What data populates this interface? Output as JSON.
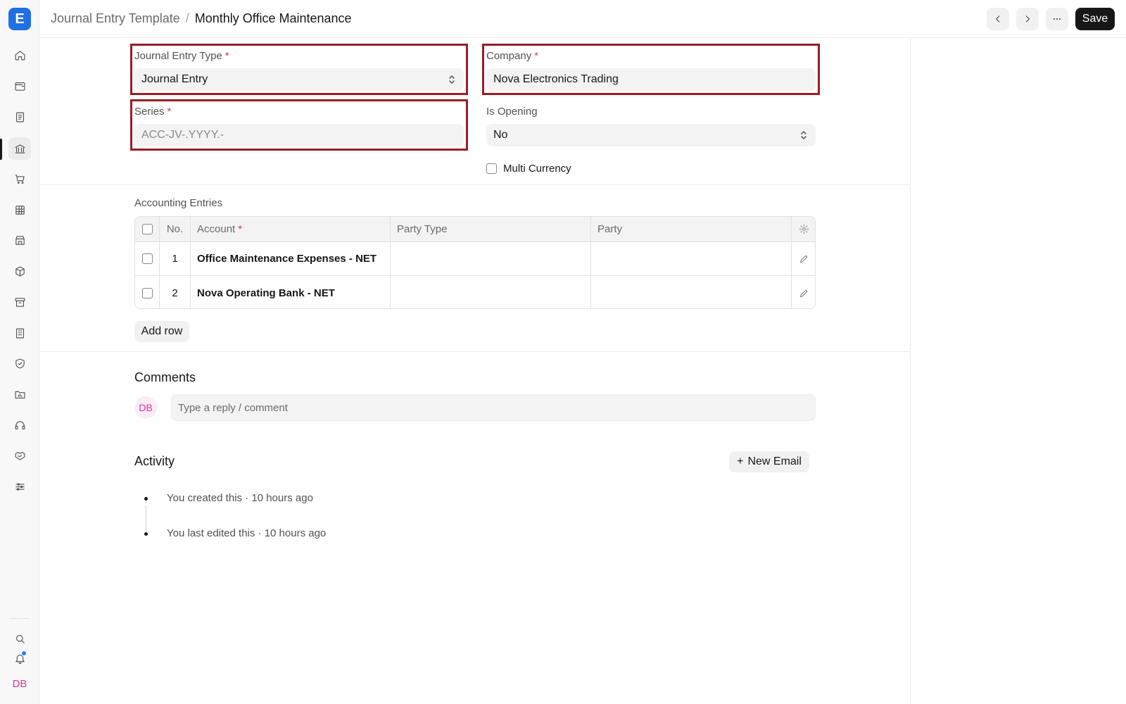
{
  "app": {
    "logo_letter": "E"
  },
  "sidebar": {
    "items": [
      {
        "icon": "home-icon"
      },
      {
        "icon": "wallet-icon"
      },
      {
        "icon": "document-icon"
      },
      {
        "icon": "bank-icon",
        "active": true
      },
      {
        "icon": "cart-icon"
      },
      {
        "icon": "table-icon"
      },
      {
        "icon": "store-icon"
      },
      {
        "icon": "box-icon"
      },
      {
        "icon": "archive-icon"
      },
      {
        "icon": "building-icon"
      },
      {
        "icon": "shield-icon"
      },
      {
        "icon": "folder-chart-icon"
      },
      {
        "icon": "headset-icon"
      },
      {
        "icon": "handshake-icon"
      },
      {
        "icon": "sliders-icon"
      }
    ],
    "bottom": {
      "search_icon": "search-icon",
      "bell_icon": "bell-icon",
      "avatar_initials": "DB"
    }
  },
  "header": {
    "breadcrumb_parent": "Journal Entry Template",
    "breadcrumb_sep": "/",
    "title": "Monthly Office Maintenance",
    "save_label": "Save"
  },
  "form": {
    "journal_entry_type": {
      "label": "Journal Entry Type",
      "required": "*",
      "value": "Journal Entry"
    },
    "company": {
      "label": "Company",
      "required": "*",
      "value": "Nova Electronics Trading"
    },
    "series": {
      "label": "Series",
      "required": "*",
      "placeholder": "ACC-JV-.YYYY.-"
    },
    "is_opening": {
      "label": "Is Opening",
      "value": "No"
    },
    "multi_currency": {
      "label": "Multi Currency",
      "checked": false
    }
  },
  "accounting": {
    "title": "Accounting Entries",
    "columns": {
      "no": "No.",
      "account": "Account",
      "account_required": "*",
      "party_type": "Party Type",
      "party": "Party"
    },
    "rows": [
      {
        "no": "1",
        "account": "Office Maintenance Expenses - NET",
        "party_type": "",
        "party": ""
      },
      {
        "no": "2",
        "account": "Nova Operating Bank - NET",
        "party_type": "",
        "party": ""
      }
    ],
    "add_row_label": "Add row"
  },
  "comments": {
    "title": "Comments",
    "avatar_initials": "DB",
    "placeholder": "Type a reply / comment"
  },
  "activity": {
    "title": "Activity",
    "new_email_label": "New Email",
    "new_email_plus": "+",
    "items": [
      {
        "text": "You created this · 10 hours ago"
      },
      {
        "text": "You last edited this · 10 hours ago"
      }
    ]
  }
}
